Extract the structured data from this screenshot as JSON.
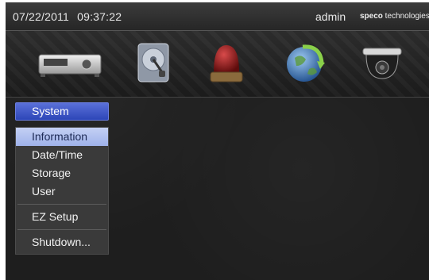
{
  "topbar": {
    "date": "07/22/2011",
    "time": "09:37:22",
    "user": "admin",
    "brand_bold": "speco",
    "brand_rest": " technologies"
  },
  "toolbar_icons": [
    "dvr-recorder-icon",
    "disk-storage-icon",
    "alarm-beacon-icon",
    "network-globe-icon",
    "dome-camera-icon"
  ],
  "menu": {
    "title": "System",
    "selected": "Information",
    "items": [
      "Information",
      "Date/Time",
      "Storage",
      "User",
      "EZ Setup",
      "Shutdown..."
    ]
  },
  "colors": {
    "menu_title": "#3a55c8",
    "selected_item": "#b3c2f0",
    "background": "#1e1e1e"
  }
}
